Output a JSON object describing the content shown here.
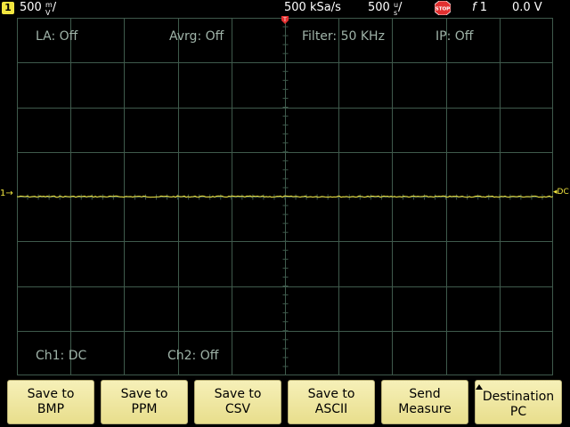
{
  "status_bar": {
    "channel_number": "1",
    "volts_div_value": "500",
    "volts_div_unit_top": "m",
    "volts_div_unit_bottom": "V",
    "volts_div_suffix": "/",
    "sample_rate": "500 kSa/s",
    "time_div_value": "500",
    "time_div_unit_top": "u",
    "time_div_unit_bottom": "s",
    "time_div_suffix": "/",
    "run_state": "STOP",
    "trigger_symbol": "f",
    "trigger_source": "1",
    "trigger_level": "0.0 V"
  },
  "overlay": {
    "la": "LA: Off",
    "avrg": "Avrg: Off",
    "filter": "Filter: 50 KHz",
    "ip": "IP: Off",
    "ch1": "Ch1: DC",
    "ch2": "Ch2: Off"
  },
  "markers": {
    "channel_marker": "1",
    "coupling_marker": "DC",
    "trigger_position_marker": "T"
  },
  "softkeys": [
    {
      "line1": "Save to",
      "line2": "BMP"
    },
    {
      "line1": "Save to",
      "line2": "PPM"
    },
    {
      "line1": "Save to",
      "line2": "CSV"
    },
    {
      "line1": "Save to",
      "line2": "ASCII"
    },
    {
      "line1": "Send",
      "line2": "Measure"
    },
    {
      "line1": "Destination",
      "line2": "PC"
    }
  ],
  "colors": {
    "background": "#000000",
    "grid": "#3f5a4c",
    "trace": "#f2e640",
    "overlay_text": "#9fb3a8",
    "softkey_fill": "#f2ebaa",
    "stop_badge": "#e23030",
    "trigger_marker": "#e23030"
  },
  "icons": {
    "stop": "stop-sign-icon",
    "trigger_edge": "rising-edge-icon",
    "destination_arrow": "triangle-up-icon"
  }
}
